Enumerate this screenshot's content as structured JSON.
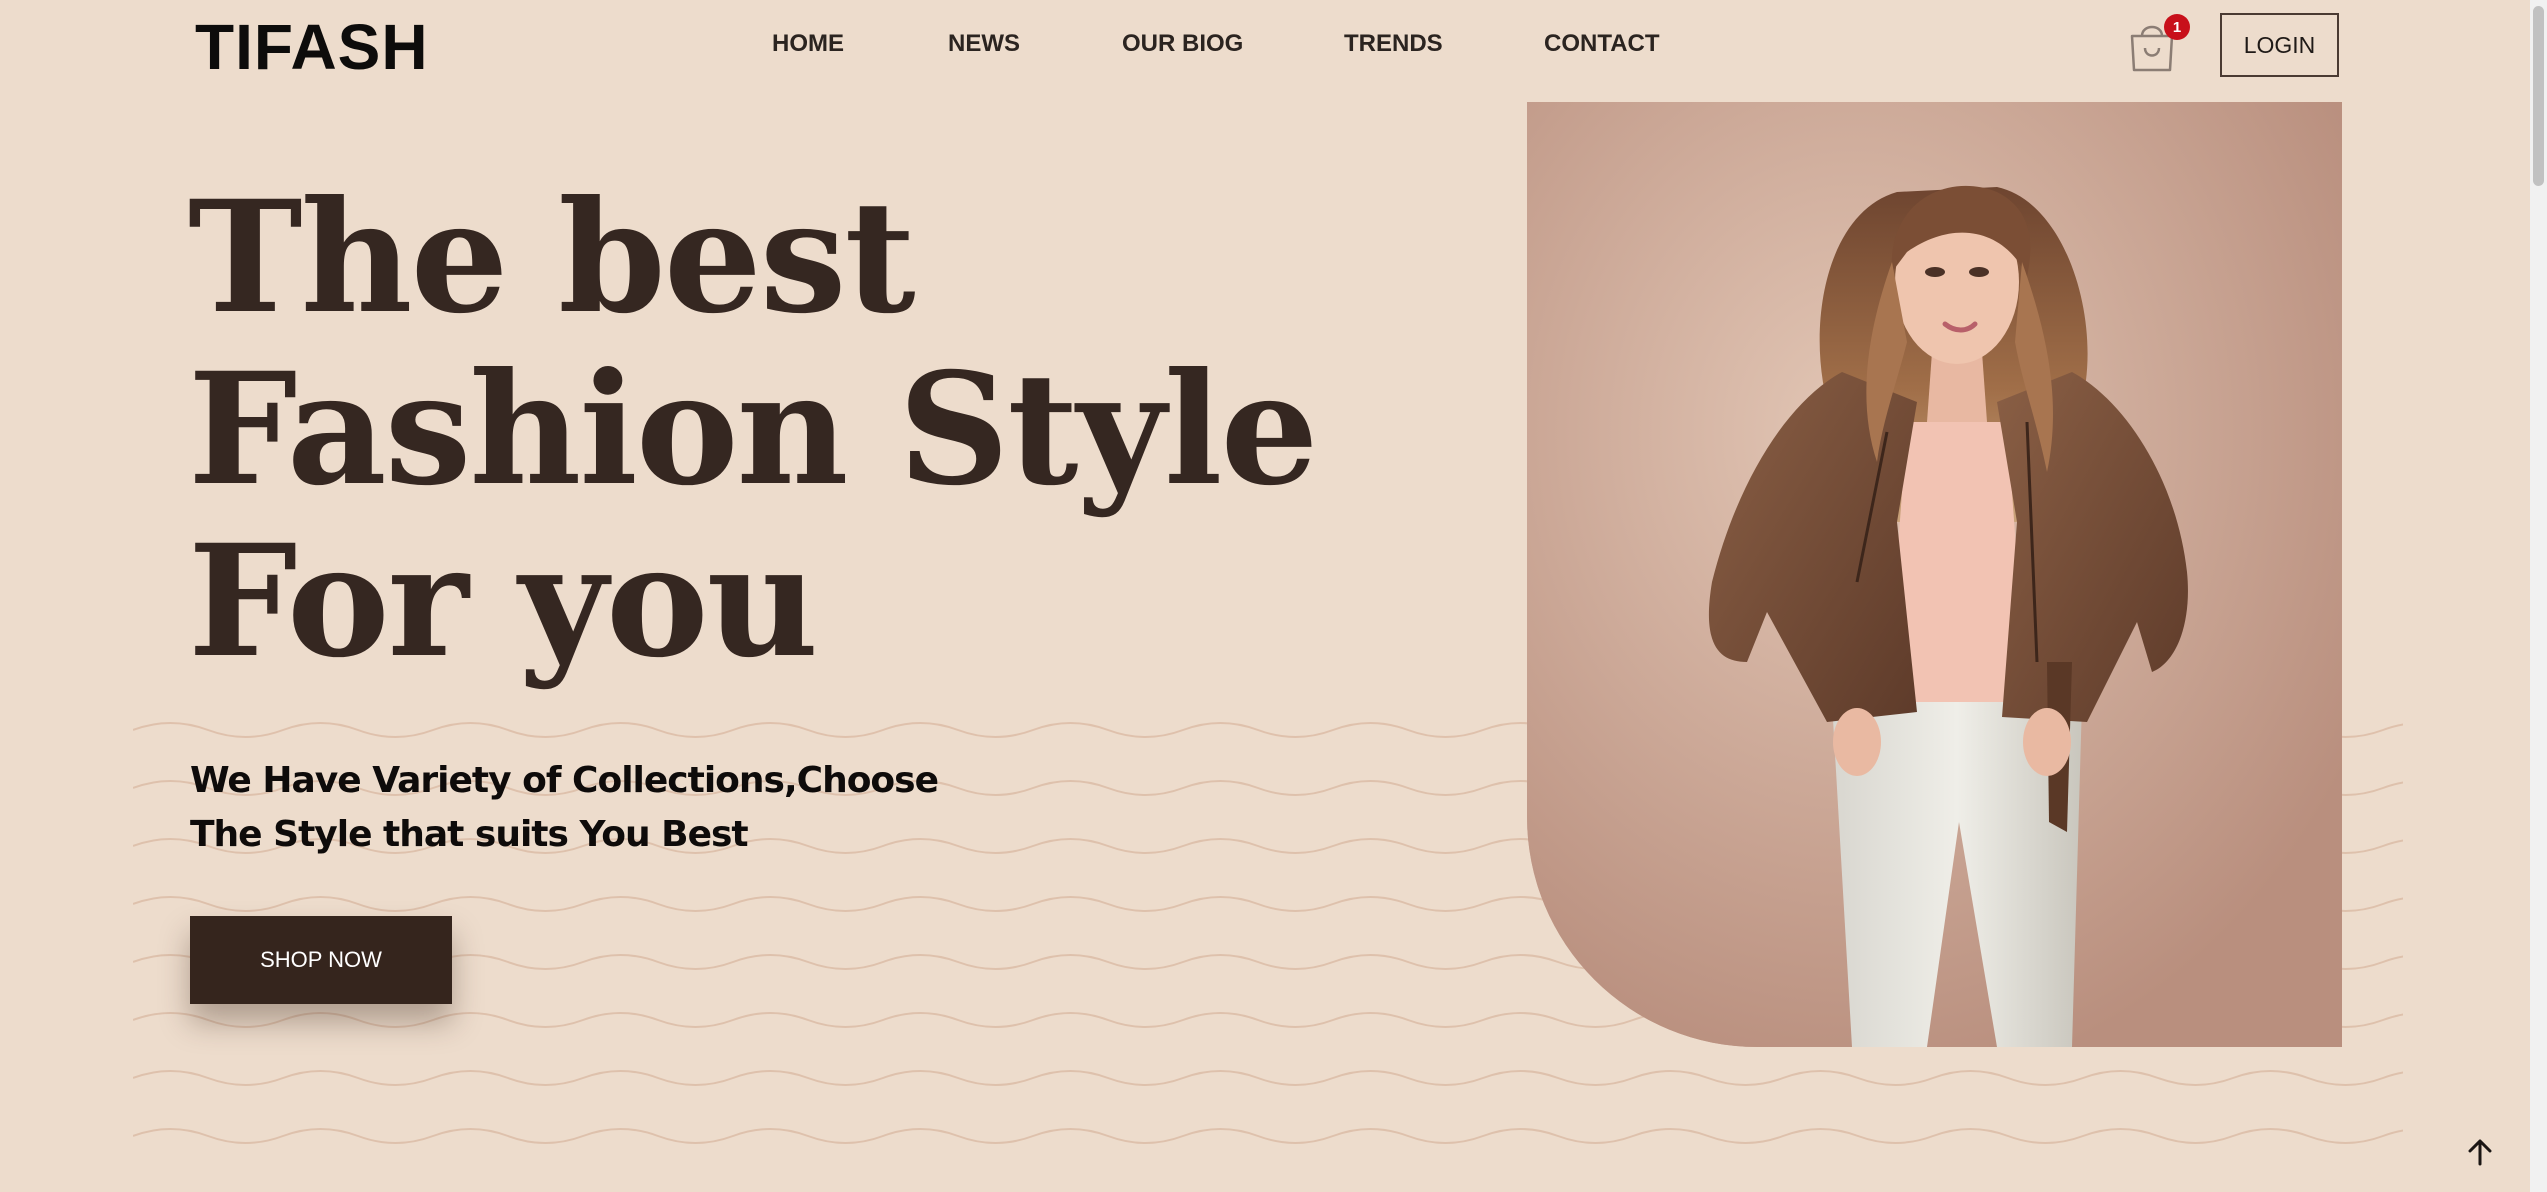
{
  "brand": {
    "name": "TIFASH"
  },
  "nav": {
    "items": [
      {
        "label": "HOME"
      },
      {
        "label": "NEWS"
      },
      {
        "label": "OUR BIOG"
      },
      {
        "label": "TRENDS"
      },
      {
        "label": "CONTACT"
      }
    ]
  },
  "cart": {
    "count": "1",
    "icon": "shopping-bag-icon"
  },
  "auth": {
    "login_label": "LOGIN"
  },
  "hero": {
    "title_lines": [
      "The best",
      "Fashion Style",
      "For you"
    ],
    "subtitle": "We Have Variety of Collections,Choose The Style that suits You Best",
    "cta_label": "SHOP NOW",
    "image": "woman-in-brown-leather-jacket-photo"
  },
  "scroll_top": {
    "icon": "arrow-up-icon"
  },
  "colors": {
    "background": "#eddccc",
    "primary": "#35251d",
    "badge": "#c8101a",
    "wave": "#d9b8a2"
  }
}
